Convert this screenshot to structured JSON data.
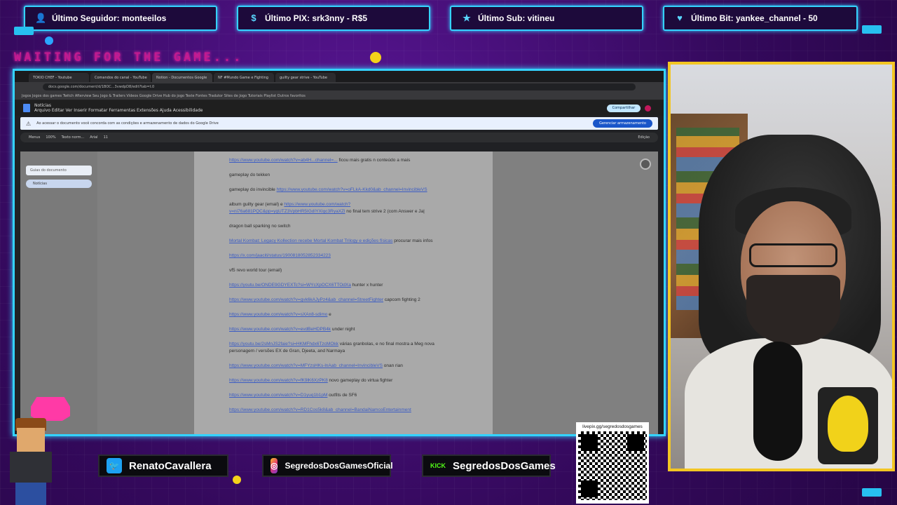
{
  "alerts": [
    {
      "icon": "user-icon",
      "label": "Último Seguidor: monteeilos"
    },
    {
      "icon": "dollar-icon",
      "label": "Último PIX: srk3nny - R$5"
    },
    {
      "icon": "star-icon",
      "label": "Último Sub: vitineu"
    },
    {
      "icon": "heart-icon",
      "label": "Último Bit: yankee_channel - 50"
    }
  ],
  "waiting_text": "WAITING FOR THE GAME...",
  "browser": {
    "tabs": [
      "TOKIO CHEF - Youtube",
      "Comandos do canal - YouTube",
      "Notion - Documentos Google",
      "NF #Mundo Game e Fighting",
      "guilty gear strive - YouTube"
    ],
    "url": "docs.google.com/document/d/1BOC...3vwdpD8/edit?tab=t.0",
    "bookmarks": "Jogos   Jogos dos games   Twitch   Afterview   Seu Jogo & Trailers   Vídeos   Google Drive   Hub do jogo   Teste   Fontes   Tradutor   Sites de Jogo   Tutoriais   Playlist   Outros favoritos",
    "doc_title": "Notícias",
    "doc_menu": "Arquivo  Editar  Ver  Inserir  Formatar  Ferramentas  Extensões  Ajuda  Acessibilidade",
    "share_label": "Compartilhar",
    "notice_text": "Ao acessar o documento você concorda com as condições e armazenamento de dados do Google Drive",
    "notice_button": "Gerenciar armazenamento",
    "toolbar_items": [
      "Menus",
      "100%",
      "Texto norm...",
      "Arial",
      "11"
    ],
    "edit_label": "Edição",
    "outline_title": "Guias do documento",
    "outline_item": "Notícias"
  },
  "doc_lines": [
    {
      "text": "",
      "link": "https://www.youtube.com/watch?v=ab4H...channel=...",
      "tail": " ficou mais gratis n conteúdo a mais"
    },
    {
      "text": "gameplay do tekken",
      "link": "",
      "tail": ""
    },
    {
      "text": "gameplay do invincible ",
      "link": "https://www.youtube.com/watch?v=oFLkA-Kkd0&ab_channel=InvincibleVS",
      "tail": ""
    },
    {
      "text": "album guilty gear (email) e ",
      "link": "https://www.youtube.com/watch?v=ni76a681PQC&pp=ygUTZ3VpbHR5IGdIYXIgc3RyaXZl",
      "tail": " no final tem strive 2 (com Answer e Ja|"
    },
    {
      "text": "dragon ball sparking no switch",
      "link": "",
      "tail": ""
    },
    {
      "text": "",
      "link": "Mortal Kombat: Legacy Kollection recebe Mortal Kombat Trilogy e edições físicas",
      "tail": " procurar mais infos"
    },
    {
      "text": "",
      "link": "https://x.com/jaaciti/status/1900818052852334223",
      "tail": ""
    },
    {
      "text": "vf5 revo world tour (email)",
      "link": "",
      "tail": ""
    },
    {
      "text": "",
      "link": "https://youtu.be/ONDE9GDYEXTc?si=WYcXpOCX6TTOdXa",
      "tail": " hunter x hunter"
    },
    {
      "text": "",
      "link": "https://www.youtube.com/watch?v=gvk6kAJyPz4&ab_channel=StreetFighter",
      "tail": " capcom fighting 2"
    },
    {
      "text": "",
      "link": "https://www.youtube.com/watch?v=sXAn8-sdimo",
      "tail": " e"
    },
    {
      "text": "",
      "link": "https://www.youtube.com/watch?v=evdBeHDPB4k",
      "tail": " under night"
    },
    {
      "text": "",
      "link": "https://youtu.be/2sMnJS2faie?si=HKMFhdx6TzcMOkk",
      "tail": " várias granbolas, e no final mostra a Meg nova personagem / versões EX de Gran, Djeeta, and Narmaya"
    },
    {
      "text": "",
      "link": "https://www.youtube.com/watch?v=MFYzsHKs-lnAab_channel=InvincibleVS",
      "tail": " onan rian"
    },
    {
      "text": "",
      "link": "https://www.youtube.com/watch?v=fK9lK6XzPK8",
      "tail": " novo gameplay do virtua fighter"
    },
    {
      "text": "",
      "link": "https://www.youtube.com/watch?v=D1yuq1b1pM",
      "tail": " outfits de SF6"
    },
    {
      "text": "",
      "link": "https://www.youtube.com/watch?v=RD1Cos5k8&ab_channel=BandaiNamcoEntertainment",
      "tail": ""
    }
  ],
  "socials": [
    {
      "icon": "twitter-icon",
      "glyph": "🐦",
      "handle": "RenatoCavallera"
    },
    {
      "icon": "instagram-icon",
      "glyph": "◎",
      "handle": "SegredosDosGamesOficial"
    },
    {
      "icon": "kick-icon",
      "glyph": "KICK",
      "handle": "SegredosDosGames"
    }
  ],
  "qr": {
    "url_text": "livepix.gg/segredosdosgames"
  },
  "colors": {
    "accent": "#34d3ff",
    "cam_border": "#f3c623",
    "background": "#3a0a64",
    "waiting": "#c21a8e"
  }
}
